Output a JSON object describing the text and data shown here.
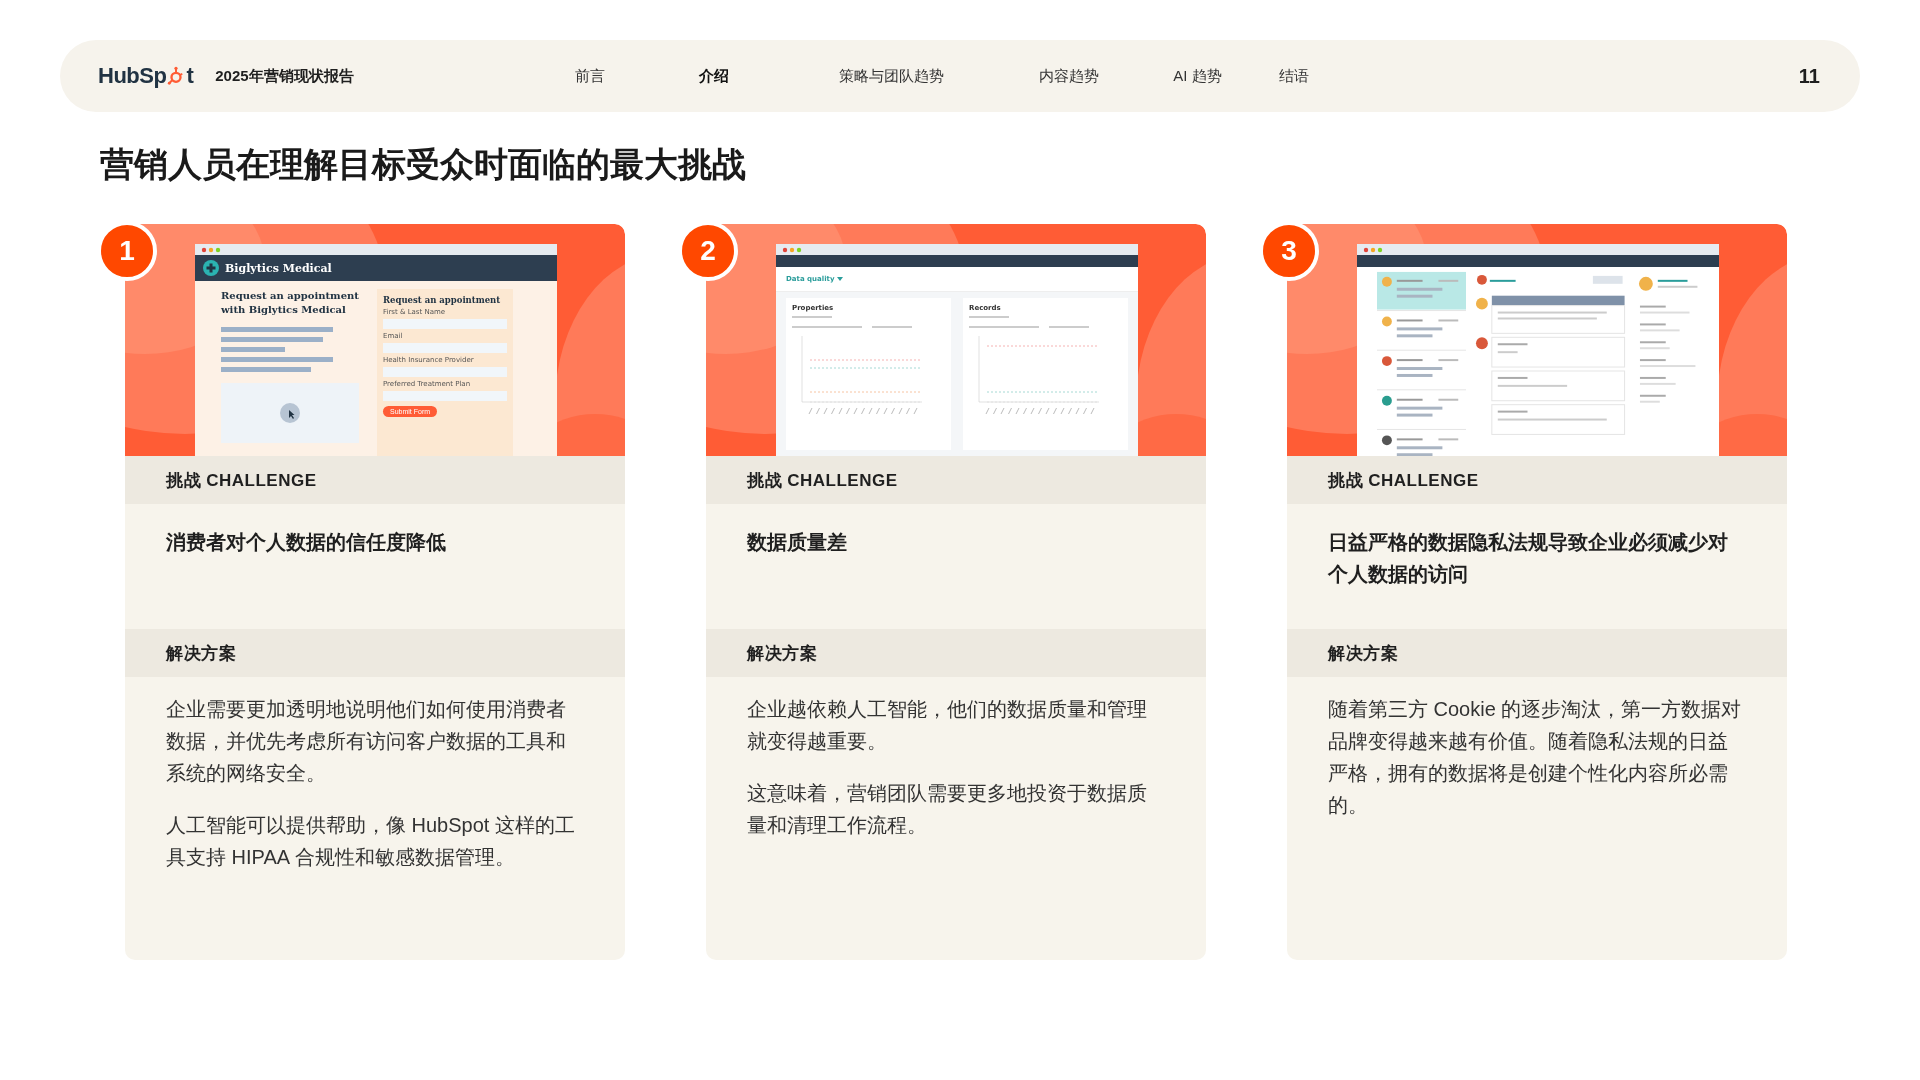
{
  "header": {
    "logo": {
      "before_icon": "HubSp",
      "after_icon": "t"
    },
    "report_title": "2025年营销现状报告",
    "nav": [
      {
        "label": "前言",
        "selected": false
      },
      {
        "label": "介绍",
        "selected": true
      },
      {
        "label": "策略与团队趋势",
        "selected": false
      },
      {
        "label": "内容趋势",
        "selected": false
      },
      {
        "label": "AI 趋势",
        "selected": false
      },
      {
        "label": "结语",
        "selected": false
      }
    ],
    "page_number": "11"
  },
  "heading": "营销人员在理解目标受众时面临的最大挑战",
  "cards": [
    {
      "number": "1",
      "screenshot": {
        "kind": "form",
        "brand": "Biglytics Medical",
        "headline": "Request an appointment with Biglytics Medical",
        "form_title": "Request an appointment",
        "fields": [
          "First & Last Name",
          "Email",
          "Health Insurance Provider",
          "Preferred Treatment Plan"
        ],
        "button": "Submit Form"
      },
      "challenge_label": "挑战 CHALLENGE",
      "challenge": "消费者对个人数据的信任度降低",
      "solution_label": "解决方案",
      "paragraphs": [
        "企业需要更加透明地说明他们如何使用消费者数据，并优先考虑所有访问客户数据的工具和系统的网络安全。",
        "人工智能可以提供帮助，像 HubSpot 这样的工具支持 HIPAA 合规性和敏感数据管理。"
      ]
    },
    {
      "number": "2",
      "screenshot": {
        "kind": "charts",
        "page_title": "Data quality",
        "panels": [
          "Properties",
          "Records"
        ]
      },
      "challenge_label": "挑战 CHALLENGE",
      "challenge": "数据质量差",
      "solution_label": "解决方案",
      "paragraphs": [
        "企业越依赖人工智能，他们的数据质量和管理就变得越重要。",
        "这意味着，营销团队需要更多地投资于数据质量和清理工作流程。"
      ]
    },
    {
      "number": "3",
      "screenshot": {
        "kind": "inbox"
      },
      "challenge_label": "挑战 CHALLENGE",
      "challenge": "日益严格的数据隐私法规导致企业必须减少对个人数据的访问",
      "solution_label": "解决方案",
      "paragraphs": [
        "随着第三方 Cookie 的逐步淘汰，第一方数据对品牌变得越来越有价值。随着隐私法规的日益严格，拥有的数据将是创建个性化内容所必需的。"
      ]
    }
  ]
}
